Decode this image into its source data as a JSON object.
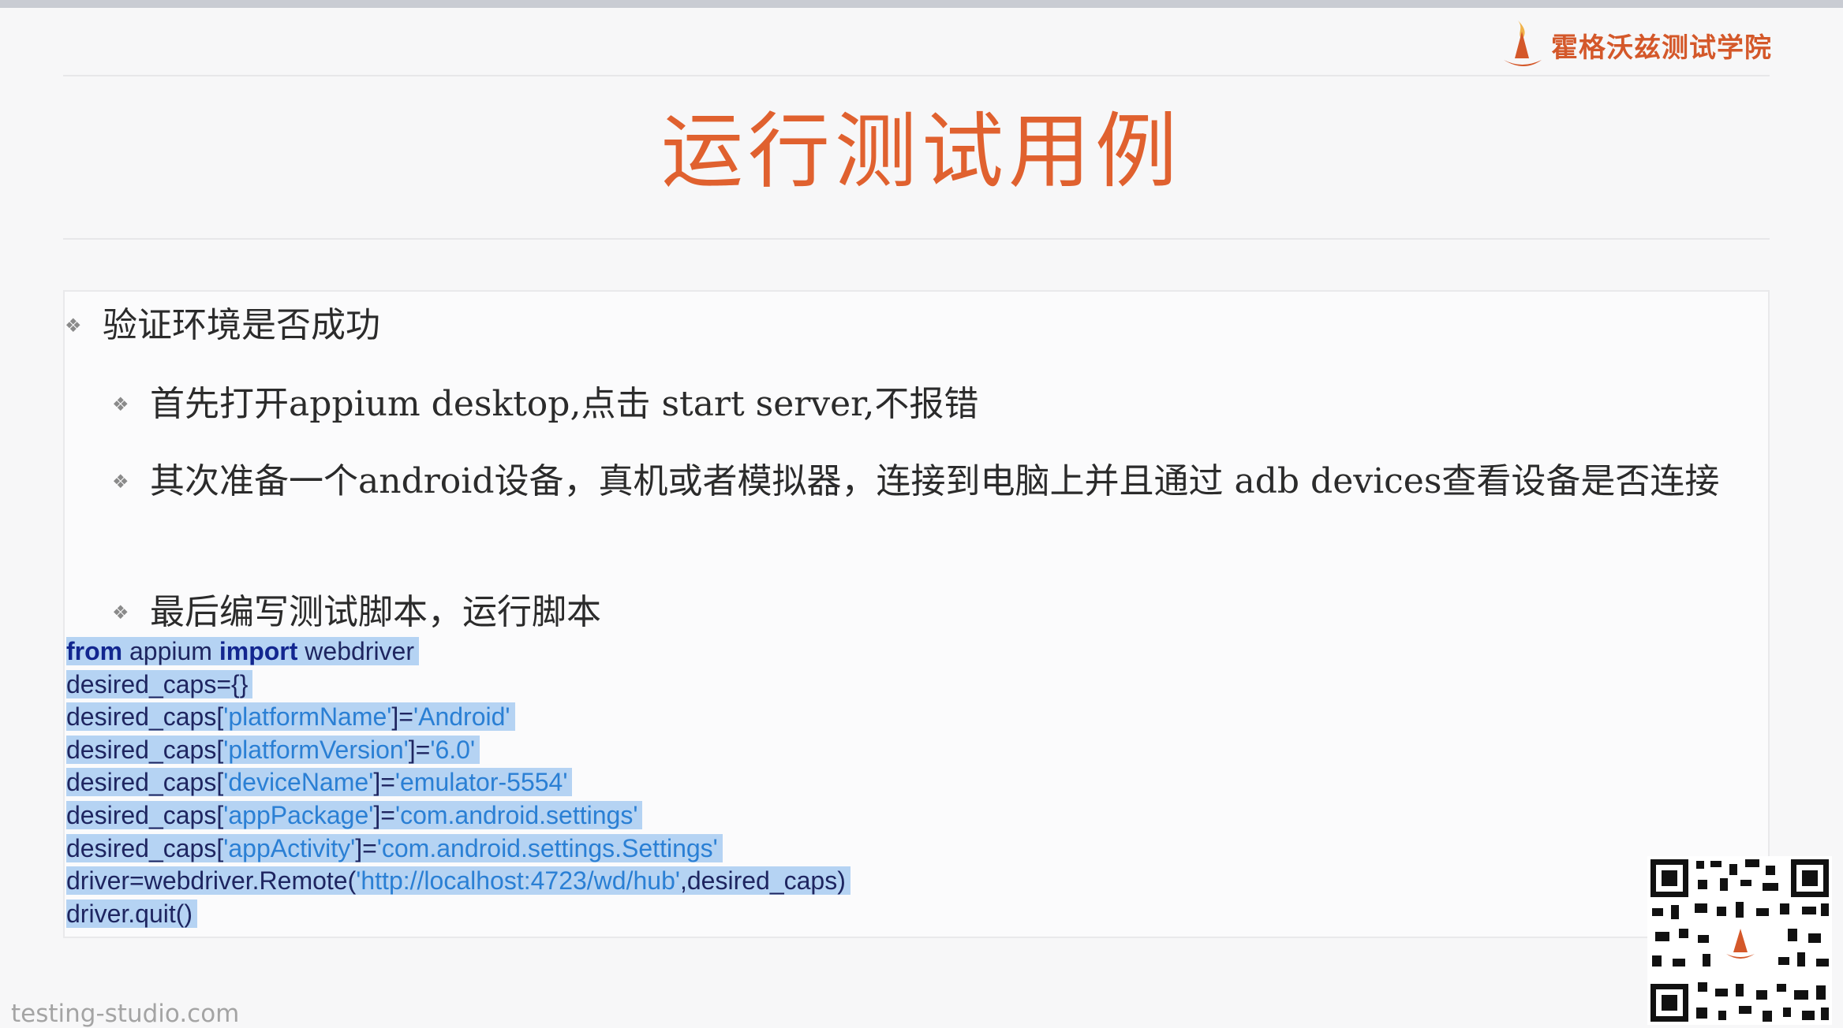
{
  "brand": {
    "name": "霍格沃兹测试学院",
    "logo_icon": "wizard-hat-flame-icon"
  },
  "slide": {
    "title": "运行测试用例"
  },
  "bullets": [
    "验证环境是否成功",
    "首先打开appium desktop,点击 start server,不报错",
    "其次准备一个android设备，真机或者模拟器，连接到电脑上并且通过 adb devices查看设备是否连接",
    "最后编写测试脚本，运行脚本"
  ],
  "code": {
    "l1": {
      "kw1": "from",
      "t1": " appium ",
      "kw2": "import",
      "t2": " webdriver"
    },
    "l2": {
      "t1": "desired_caps={}"
    },
    "l3": {
      "p": "desired_caps[",
      "k": "'platformName'",
      "m": "]=",
      "v": "'Android'"
    },
    "l4": {
      "p": "desired_caps[",
      "k": "'platformVersion'",
      "m": "]=",
      "v": "'6.0'"
    },
    "l5": {
      "p": "desired_caps[",
      "k": "'deviceName'",
      "m": "]=",
      "v": "'emulator-5554'"
    },
    "l6": {
      "p": "desired_caps[",
      "k": "'appPackage'",
      "m": "]=",
      "v": "'com.android.settings'"
    },
    "l7": {
      "p": "desired_caps[",
      "k": "'appActivity'",
      "m": "]=",
      "v": "'com.android.settings.Settings'"
    },
    "l8": {
      "p": "driver=webdriver.Remote(",
      "s": "'http://localhost:4723/wd/hub'",
      "e": ",desired_caps)"
    },
    "l9": {
      "t1": "driver.quit()"
    }
  },
  "footer": {
    "site": "testing-studio.com"
  },
  "colors": {
    "title": "#e0612f",
    "brand": "#d4582a",
    "highlight": "#b5d3f3",
    "keyword": "#12268f",
    "string": "#2a7fd4"
  },
  "qr": {
    "icon": "qr-code-icon"
  }
}
